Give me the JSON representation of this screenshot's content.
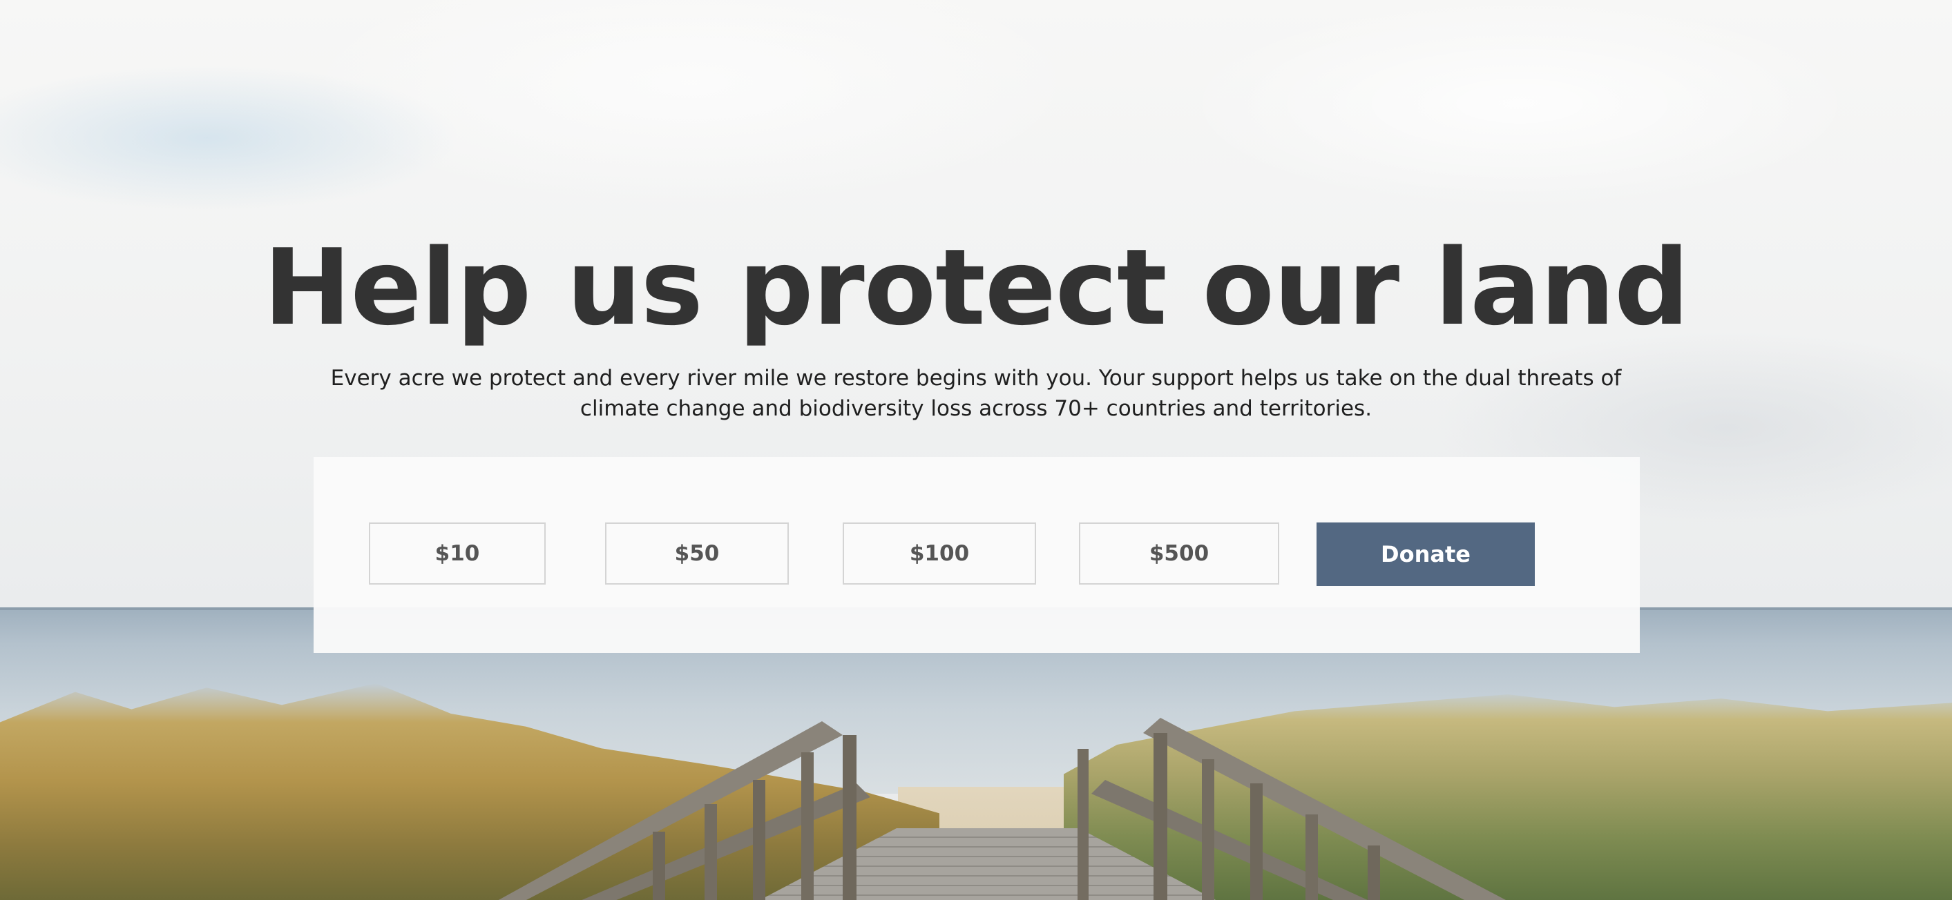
{
  "hero": {
    "headline": "Help us protect our land",
    "description": "Every acre we protect and every river mile we restore begins with you. Your support helps us take on the dual threats of climate change and biodiversity loss across 70+ countries and territories.",
    "background_image": "beach boardwalk through dune grass toward the sea"
  },
  "donation": {
    "amounts": [
      {
        "label": "$10"
      },
      {
        "label": "$50"
      },
      {
        "label": "$100"
      },
      {
        "label": "$500"
      }
    ],
    "donate_label": "Donate"
  },
  "colors": {
    "headline": "#333333",
    "donate_button": "#536882",
    "panel": "#fafafa",
    "amount_border": "#d4d4d4"
  }
}
